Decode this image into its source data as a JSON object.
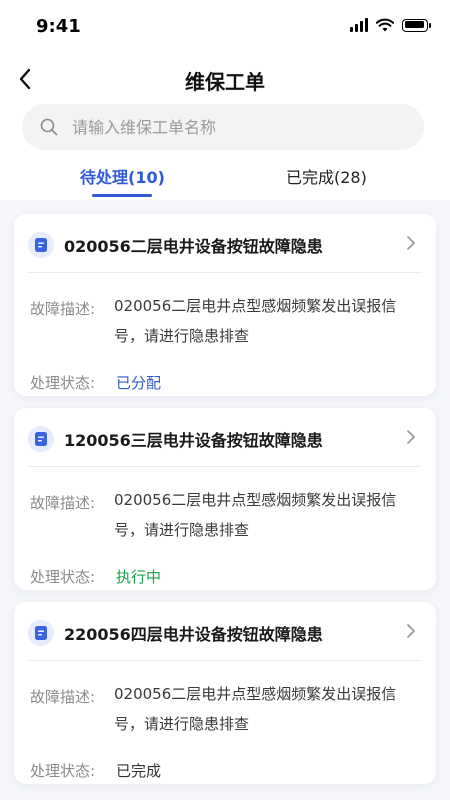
{
  "status_bar": {
    "time": "9:41"
  },
  "nav": {
    "title": "维保工单"
  },
  "search": {
    "placeholder": "请输入维保工单名称"
  },
  "tabs": [
    {
      "label": "待处理(10)",
      "active": true
    },
    {
      "label": "已完成(28)",
      "active": false
    }
  ],
  "fields": {
    "desc_label": "故障描述:",
    "status_label": "处理状态:"
  },
  "orders": [
    {
      "title": "020056二层电井设备按钮故障隐患",
      "description": "020056二层电井点型感烟频繁发出误报信号，请进行隐患排查",
      "status": "已分配",
      "status_color": "#2f5bd6"
    },
    {
      "title": "120056三层电井设备按钮故障隐患",
      "description": "020056二层电井点型感烟频繁发出误报信号，请进行隐患排查",
      "status": "执行中",
      "status_color": "#1aa34a"
    },
    {
      "title": "220056四层电井设备按钮故障隐患",
      "description": "020056二层电井点型感烟频繁发出误报信号，请进行隐患排查",
      "status": "已完成",
      "status_color": "#333333"
    }
  ],
  "colors": {
    "accent": "#2f5bd6",
    "background": "#f4f6fa"
  }
}
